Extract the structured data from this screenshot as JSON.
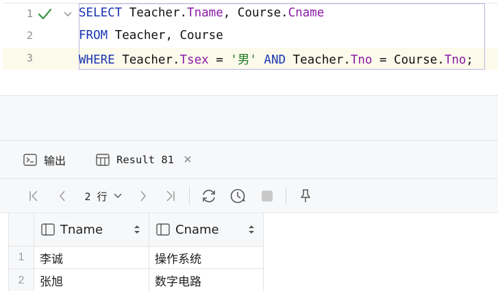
{
  "editor": {
    "lines": [
      {
        "num": "1",
        "tokens": [
          {
            "t": "SELECT",
            "c": "kw"
          },
          {
            "t": " Teacher.",
            "c": ""
          },
          {
            "t": "Tname",
            "c": "fld"
          },
          {
            "t": ", Course.",
            "c": ""
          },
          {
            "t": "Cname",
            "c": "fld"
          }
        ]
      },
      {
        "num": "2",
        "tokens": [
          {
            "t": "FROM",
            "c": "kw"
          },
          {
            "t": " Teacher, Course",
            "c": ""
          }
        ]
      },
      {
        "num": "3",
        "tokens": [
          {
            "t": "WHERE",
            "c": "kw"
          },
          {
            "t": " Teacher.",
            "c": ""
          },
          {
            "t": "Tsex",
            "c": "fld"
          },
          {
            "t": " = ",
            "c": ""
          },
          {
            "t": "'男'",
            "c": "str"
          },
          {
            "t": " ",
            "c": ""
          },
          {
            "t": "AND",
            "c": "kw"
          },
          {
            "t": " Teacher.",
            "c": ""
          },
          {
            "t": "Tno",
            "c": "fld"
          },
          {
            "t": " = Course.",
            "c": ""
          },
          {
            "t": "Tno",
            "c": "fld"
          },
          {
            "t": ";",
            "c": ""
          }
        ]
      }
    ],
    "status_icon": "check-icon"
  },
  "tabs": {
    "output_label": "输出",
    "result_label": "Result 81"
  },
  "toolbar": {
    "rows_label": "2 行"
  },
  "grid": {
    "columns": [
      "Tname",
      "Cname"
    ],
    "rows": [
      {
        "num": "1",
        "cells": [
          "李诚",
          "操作系统"
        ]
      },
      {
        "num": "2",
        "cells": [
          "张旭",
          "数字电路"
        ]
      }
    ]
  },
  "colors": {
    "keyword": "#1a36b0",
    "field": "#8a1aa6",
    "string": "#1d7a22",
    "check": "#3f9a4f",
    "current_line": "#fcfaeb"
  }
}
